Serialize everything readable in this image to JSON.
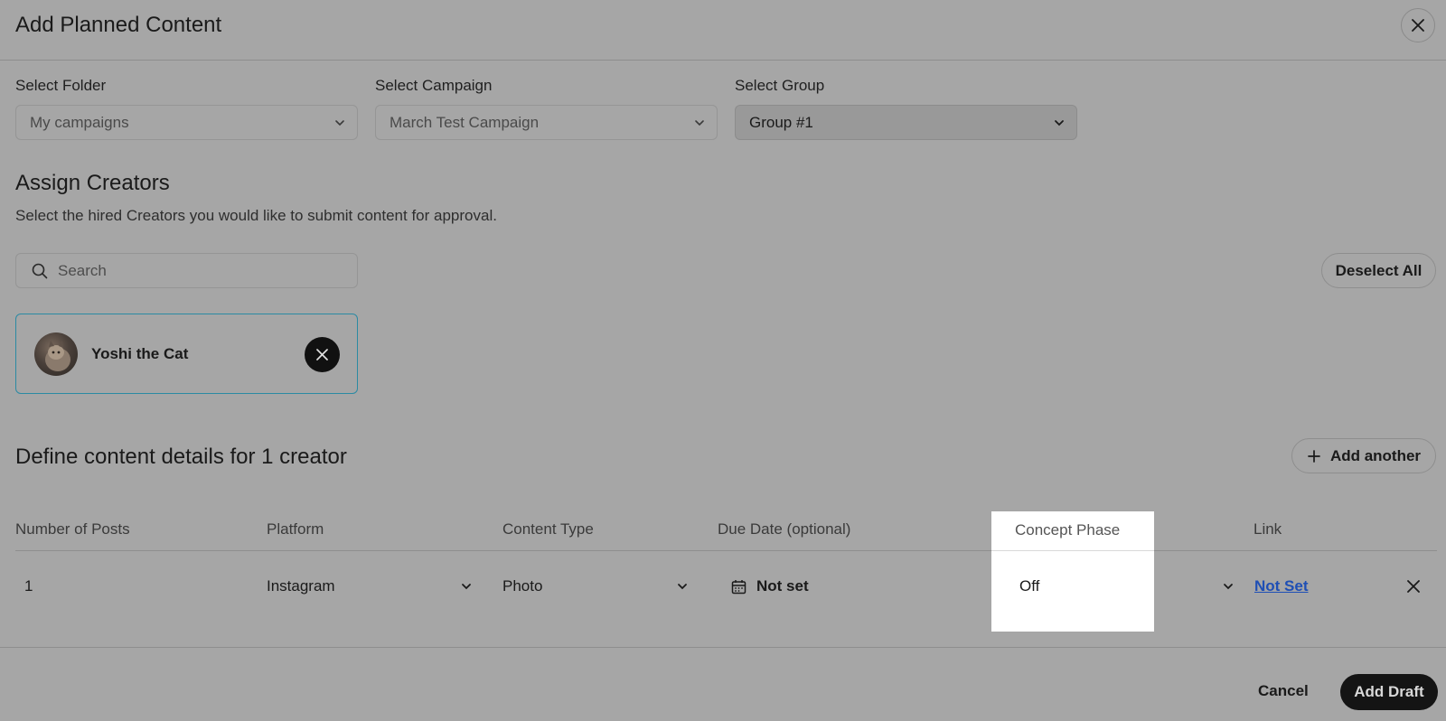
{
  "header": {
    "title": "Add Planned Content"
  },
  "selects": {
    "folder": {
      "label": "Select Folder",
      "value": "My campaigns"
    },
    "campaign": {
      "label": "Select Campaign",
      "value": "March Test Campaign"
    },
    "group": {
      "label": "Select Group",
      "value": "Group #1"
    }
  },
  "assign": {
    "title": "Assign Creators",
    "description": "Select the hired Creators you would like to submit content for approval.",
    "search_placeholder": "Search",
    "deselect_all": "Deselect All",
    "creators": [
      {
        "name": "Yoshi the Cat"
      }
    ]
  },
  "details": {
    "title": "Define content details for 1 creator",
    "add_another": "Add another",
    "columns": {
      "posts": "Number of Posts",
      "platform": "Platform",
      "content_type": "Content Type",
      "due_date": "Due Date (optional)",
      "concept": "Concept Phase",
      "link": "Link"
    },
    "row": {
      "posts": "1",
      "platform": "Instagram",
      "content_type": "Photo",
      "due_date": "Not set",
      "concept": "Off",
      "link": "Not Set"
    }
  },
  "footer": {
    "cancel": "Cancel",
    "add_draft": "Add Draft"
  }
}
